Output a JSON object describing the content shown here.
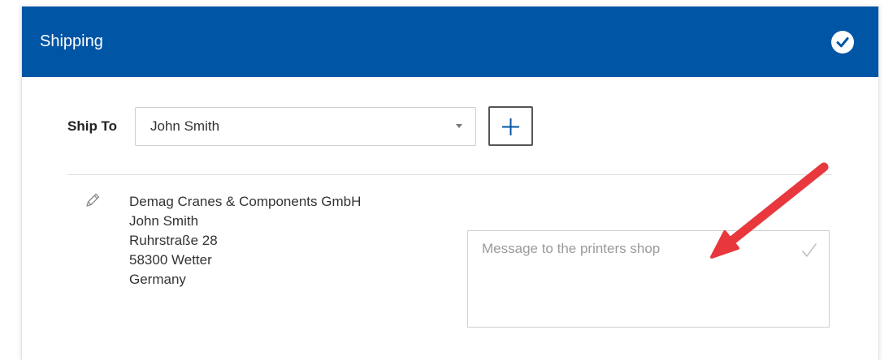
{
  "panel": {
    "title": "Shipping",
    "header_color": "#0055a5",
    "completed_icon": "check-circle-icon"
  },
  "ship_to": {
    "label": "Ship To",
    "selected": "John Smith",
    "add_icon": "plus-icon"
  },
  "address": {
    "edit_icon": "pencil-icon",
    "lines": [
      "Demag Cranes & Components GmbH",
      "John Smith",
      "Ruhrstraße 28",
      "58300 Wetter",
      "Germany"
    ]
  },
  "message": {
    "value": "",
    "placeholder": "Message to the printers shop",
    "check_icon": "checkmark-icon"
  },
  "annotation": {
    "arrow_color": "#e8383d"
  }
}
